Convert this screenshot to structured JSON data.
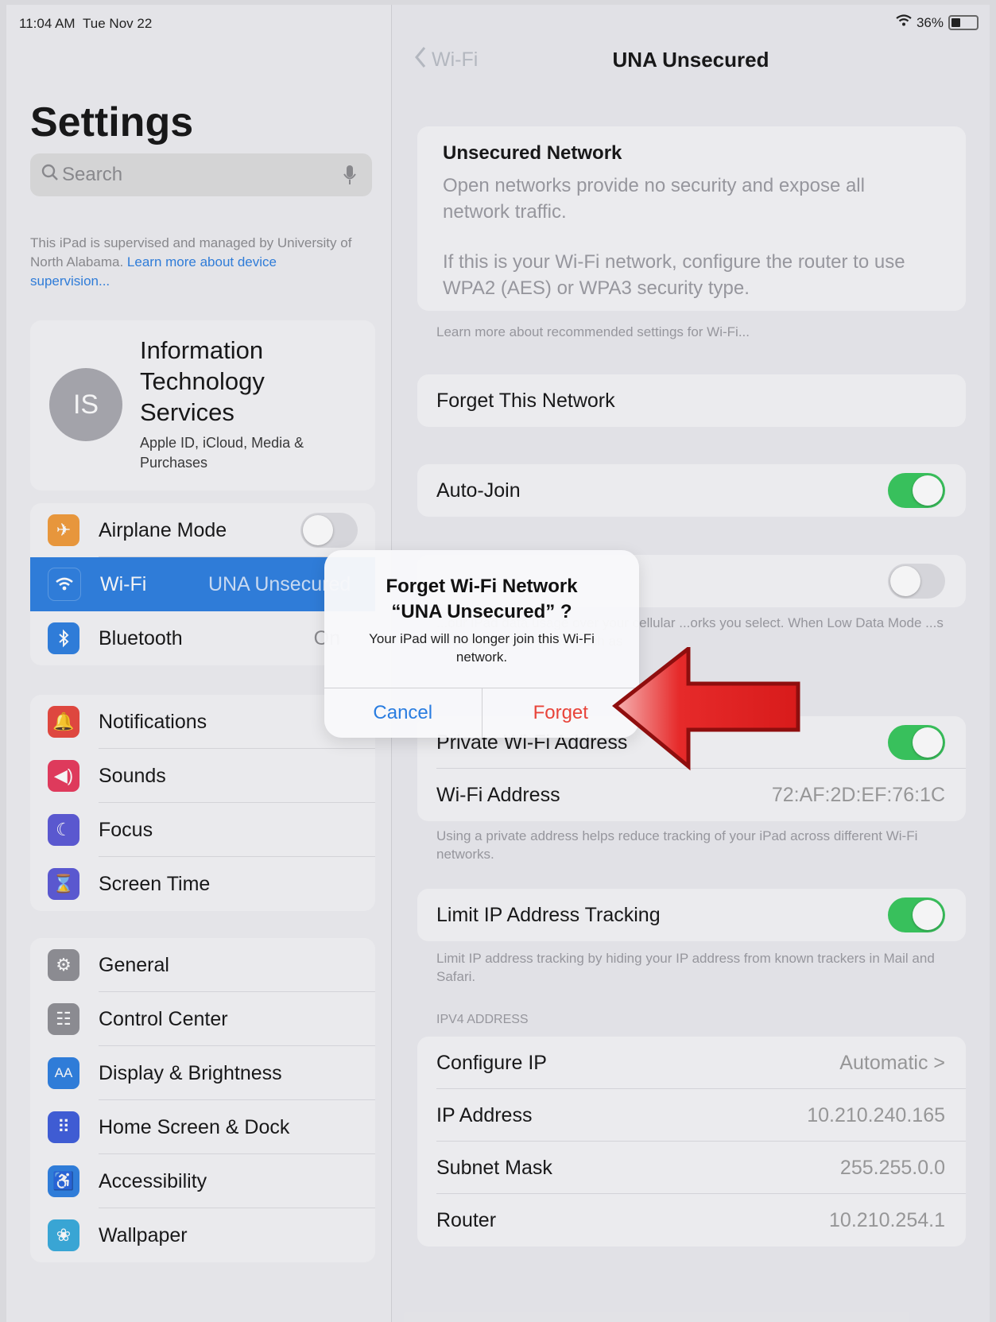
{
  "status": {
    "time": "11:04 AM",
    "date": "Tue Nov 22",
    "battery": "36%",
    "battery_level": 0.36
  },
  "sidebar": {
    "title": "Settings",
    "search_placeholder": "Search",
    "supervision_text": "This iPad is supervised and managed by University of North Alabama.",
    "supervision_link": "Learn more about device supervision...",
    "profile": {
      "initials": "IS",
      "name": "Information Technology Services",
      "subtitle": "Apple ID, iCloud, Media & Purchases"
    },
    "group1": [
      {
        "label": "Airplane Mode",
        "icon": "airplane-icon",
        "color": "#f19a37",
        "toggle": false
      },
      {
        "label": "Wi-Fi",
        "icon": "wifi-icon",
        "color": "#2a7de0",
        "value": "UNA Unsecured",
        "active": true
      },
      {
        "label": "Bluetooth",
        "icon": "bluetooth-icon",
        "color": "#2a7de0",
        "value": "On"
      }
    ],
    "group2": [
      {
        "label": "Notifications",
        "icon": "bell-icon",
        "color": "#e8443a"
      },
      {
        "label": "Sounds",
        "icon": "speaker-icon",
        "color": "#e8365a"
      },
      {
        "label": "Focus",
        "icon": "moon-icon",
        "color": "#5856d6"
      },
      {
        "label": "Screen Time",
        "icon": "hourglass-icon",
        "color": "#5856d6"
      }
    ],
    "group3": [
      {
        "label": "General",
        "icon": "gear-icon",
        "color": "#8e8e93"
      },
      {
        "label": "Control Center",
        "icon": "switches-icon",
        "color": "#8e8e93"
      },
      {
        "label": "Display & Brightness",
        "icon": "aa-icon",
        "color": "#2a7de0"
      },
      {
        "label": "Home Screen & Dock",
        "icon": "grid-icon",
        "color": "#3b5bdb"
      },
      {
        "label": "Accessibility",
        "icon": "accessibility-icon",
        "color": "#2a7de0"
      },
      {
        "label": "Wallpaper",
        "icon": "flower-icon",
        "color": "#35aadc"
      }
    ]
  },
  "detail": {
    "back_label": "Wi-Fi",
    "title": "UNA Unsecured",
    "unsecured": {
      "title": "Unsecured Network",
      "text1": "Open networks provide no security and expose all network traffic.",
      "text2": "If this is your Wi-Fi network, configure the router to use WPA2 (AES) or WPA3 security type."
    },
    "learn_more": "Learn more about recommended settings for Wi-Fi...",
    "forget_network": "Forget This Network",
    "auto_join": {
      "label": "Auto-Join",
      "on": true
    },
    "low_data_on": false,
    "low_data_footer": "...our iPad data usage over your cellular ...orks you select. When Low Data Mode ...s and background tasks, such as",
    "private_address": {
      "label": "Private Wi-Fi Address",
      "on": true
    },
    "wifi_address": {
      "label": "Wi-Fi Address",
      "value": "72:AF:2D:EF:76:1C"
    },
    "private_footer": "Using a private address helps reduce tracking of your iPad across different Wi-Fi networks.",
    "limit_ip": {
      "label": "Limit IP Address Tracking",
      "on": true
    },
    "limit_footer": "Limit IP address tracking by hiding your IP address from known trackers in Mail and Safari.",
    "ipv4_header": "IPV4 ADDRESS",
    "ipv4": [
      {
        "label": "Configure IP",
        "value": "Automatic >"
      },
      {
        "label": "IP Address",
        "value": "10.210.240.165"
      },
      {
        "label": "Subnet Mask",
        "value": "255.255.0.0"
      },
      {
        "label": "Router",
        "value": "10.210.254.1"
      }
    ]
  },
  "alert": {
    "title_line1": "Forget Wi-Fi Network",
    "title_line2": "“UNA Unsecured” ?",
    "message": "Your iPad will no longer join this Wi-Fi network.",
    "cancel": "Cancel",
    "forget": "Forget"
  }
}
